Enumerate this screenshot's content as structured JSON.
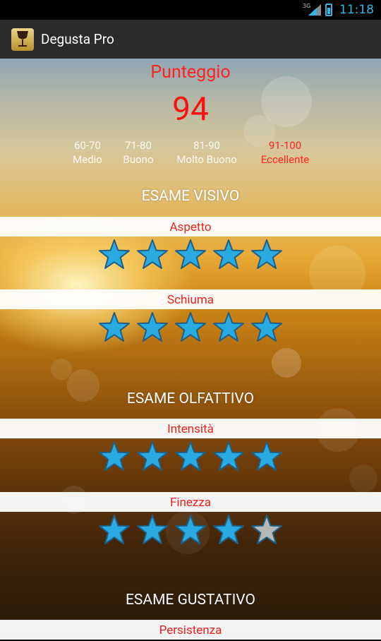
{
  "status_bar": {
    "network": "3G",
    "time": "11:18"
  },
  "action_bar": {
    "title": "Degusta Pro",
    "icon": "wine-glass-icon"
  },
  "score": {
    "label": "Punteggio",
    "value": "94"
  },
  "legend": [
    {
      "range": "60-70",
      "label": "Medio",
      "active": false
    },
    {
      "range": "71-80",
      "label": "Buono",
      "active": false
    },
    {
      "range": "81-90",
      "label": "Molto Buono",
      "active": false
    },
    {
      "range": "91-100",
      "label": "Eccellente",
      "active": true
    }
  ],
  "sections": [
    {
      "title": "ESAME VISIVO",
      "criteria": [
        {
          "label": "Aspetto",
          "rating": 5
        },
        {
          "label": "Schiuma",
          "rating": 5
        }
      ]
    },
    {
      "title": "ESAME OLFATTIVO",
      "criteria": [
        {
          "label": "Intensità",
          "rating": 5
        },
        {
          "label": "Finezza",
          "rating": 4
        }
      ]
    },
    {
      "title": "ESAME GUSTATIVO",
      "criteria": [
        {
          "label": "Persistenza",
          "rating": null
        }
      ]
    }
  ],
  "max_rating": 5,
  "colors": {
    "star_filled": "#29abe2",
    "star_empty": "#b7b7b7",
    "accent_red": "#e8231f"
  }
}
